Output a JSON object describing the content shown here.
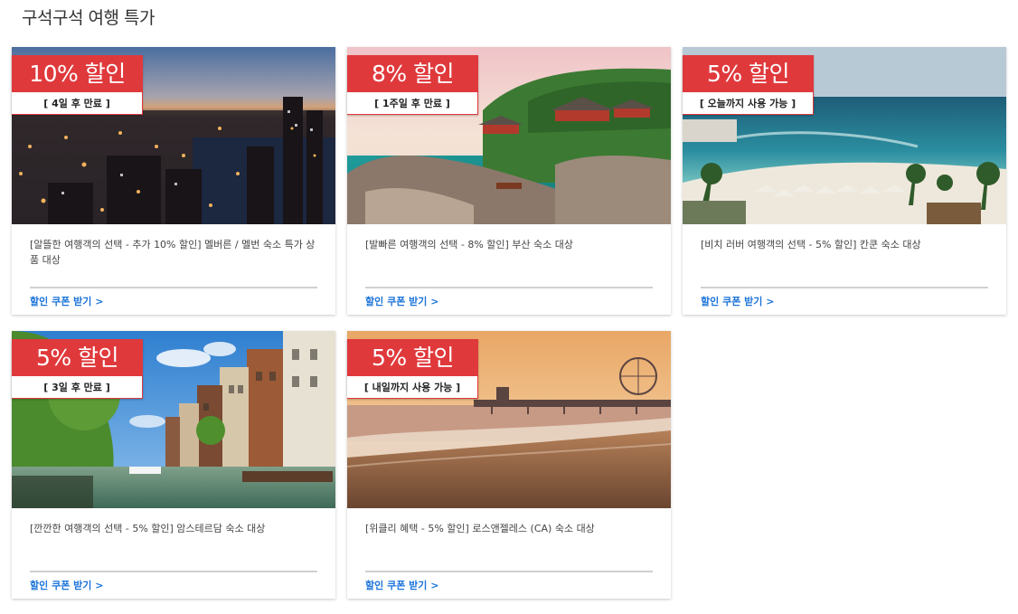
{
  "page": {
    "title": "구석구석 여행 특가"
  },
  "deals": [
    {
      "discount": "10% 할인",
      "expiry": "[ 4일 후 만료 ]",
      "description": "[알뜰한 여행객의 선택 - 추가 10% 할인] 멜버른 / 멜번 숙소 특가 상품 대상",
      "cta": "할인 쿠폰 받기 >",
      "photo": "melbourne-night-city-image"
    },
    {
      "discount": "8% 할인",
      "expiry": "[ 1주일 후 만료 ]",
      "description": "[발빠른 여행객의 선택 - 8% 할인] 부산 숙소 대상",
      "cta": "할인 쿠폰 받기 >",
      "photo": "busan-coastal-temple-image"
    },
    {
      "discount": "5% 할인",
      "expiry": "[ 오늘까지 사용 가능 ]",
      "description": "[비치 러버 여행객의 선택 - 5% 할인] 칸쿤 숙소 대상",
      "cta": "할인 쿠폰 받기 >",
      "photo": "cancun-beach-image"
    },
    {
      "discount": "5% 할인",
      "expiry": "[ 3일 후 만료 ]",
      "description": "[깐깐한 여행객의 선택 - 5% 할인] 암스테르담 숙소 대상",
      "cta": "할인 쿠폰 받기 >",
      "photo": "amsterdam-canal-image"
    },
    {
      "discount": "5% 할인",
      "expiry": "[ 내일까지 사용 가능 ]",
      "description": "[위클리 혜택 - 5% 할인] 로스앤젤레스 (CA) 숙소 대상",
      "cta": "할인 쿠폰 받기 >",
      "photo": "los-angeles-pier-beach-image"
    }
  ],
  "colors": {
    "badge": "#e0393c",
    "link": "#1a73d9"
  }
}
